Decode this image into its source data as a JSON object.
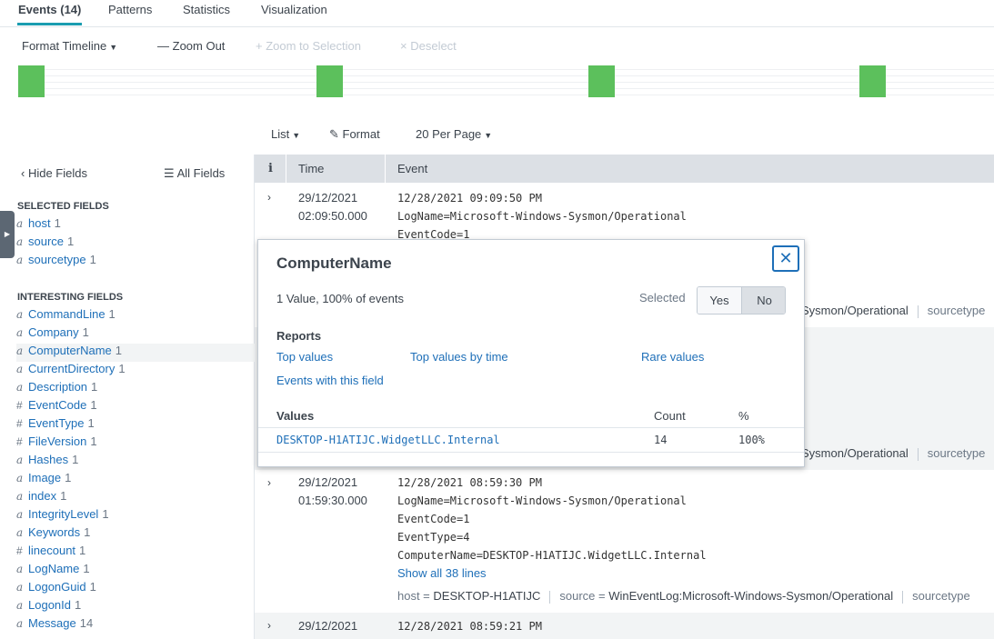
{
  "tabs": [
    {
      "label": "Events (14)"
    },
    {
      "label": "Patterns"
    },
    {
      "label": "Statistics"
    },
    {
      "label": "Visualization"
    }
  ],
  "timeline_toolbar": {
    "format": "Format Timeline",
    "zoom_out": "Zoom Out",
    "zoom_selection": "Zoom to Selection",
    "deselect": "Deselect"
  },
  "results_toolbar": {
    "list": "List",
    "format": "Format",
    "per_page": "20 Per Page"
  },
  "sidebar": {
    "hide_fields": "Hide Fields",
    "all_fields": "All Fields",
    "selected_title": "SELECTED FIELDS",
    "selected": [
      {
        "type": "a",
        "name": "host",
        "count": "1"
      },
      {
        "type": "a",
        "name": "source",
        "count": "1"
      },
      {
        "type": "a",
        "name": "sourcetype",
        "count": "1"
      }
    ],
    "interesting_title": "INTERESTING FIELDS",
    "interesting": [
      {
        "type": "a",
        "name": "CommandLine",
        "count": "1"
      },
      {
        "type": "a",
        "name": "Company",
        "count": "1"
      },
      {
        "type": "a",
        "name": "ComputerName",
        "count": "1"
      },
      {
        "type": "a",
        "name": "CurrentDirectory",
        "count": "1"
      },
      {
        "type": "a",
        "name": "Description",
        "count": "1"
      },
      {
        "type": "#",
        "name": "EventCode",
        "count": "1"
      },
      {
        "type": "#",
        "name": "EventType",
        "count": "1"
      },
      {
        "type": "#",
        "name": "FileVersion",
        "count": "1"
      },
      {
        "type": "a",
        "name": "Hashes",
        "count": "1"
      },
      {
        "type": "a",
        "name": "Image",
        "count": "1"
      },
      {
        "type": "a",
        "name": "index",
        "count": "1"
      },
      {
        "type": "a",
        "name": "IntegrityLevel",
        "count": "1"
      },
      {
        "type": "a",
        "name": "Keywords",
        "count": "1"
      },
      {
        "type": "#",
        "name": "linecount",
        "count": "1"
      },
      {
        "type": "a",
        "name": "LogName",
        "count": "1"
      },
      {
        "type": "a",
        "name": "LogonGuid",
        "count": "1"
      },
      {
        "type": "a",
        "name": "LogonId",
        "count": "1"
      },
      {
        "type": "a",
        "name": "Message",
        "count": "14"
      }
    ]
  },
  "table": {
    "col_info": "i",
    "col_time": "Time",
    "col_event": "Event"
  },
  "events": [
    {
      "date": "29/12/2021",
      "time": "02:09:50.000",
      "lines": [
        "12/28/2021 09:09:50 PM",
        "LogName=Microsoft-Windows-Sysmon/Operational",
        "EventCode=1"
      ]
    },
    {
      "meta_tail": "Sysmon/Operational",
      "sourcetype_key": "sourcetype"
    },
    {
      "meta_tail": "Sysmon/Operational",
      "sourcetype_key": "sourcetype"
    },
    {
      "date": "29/12/2021",
      "time": "01:59:30.000",
      "lines": [
        "12/28/2021 08:59:30 PM",
        "LogName=Microsoft-Windows-Sysmon/Operational",
        "EventCode=1",
        "EventType=4",
        "ComputerName=DESKTOP-H1ATIJC.WidgetLLC.Internal"
      ],
      "show_all": "Show all 38 lines",
      "host_key": "host =",
      "host_val": "DESKTOP-H1ATIJC",
      "source_key": "source =",
      "source_val": "WinEventLog:Microsoft-Windows-Sysmon/Operational",
      "sourcetype_key": "sourcetype"
    },
    {
      "date": "29/12/2021",
      "lines": [
        "12/28/2021 08:59:21 PM"
      ]
    }
  ],
  "popover": {
    "title": "ComputerName",
    "summary": "1 Value, 100% of events",
    "selected_label": "Selected",
    "yes": "Yes",
    "no": "No",
    "reports_title": "Reports",
    "links": {
      "top_values": "Top values",
      "top_values_by_time": "Top values by time",
      "rare_values": "Rare values",
      "events_with_field": "Events with this field"
    },
    "values_head": "Values",
    "count_head": "Count",
    "pct_head": "%",
    "value": "DESKTOP-H1ATIJC.WidgetLLC.Internal",
    "value_count": "14",
    "value_pct": "100%"
  },
  "colors": {
    "accent": "#1a9cb0",
    "link": "#1e6fb8",
    "timeline_bar": "#5cc05c"
  }
}
